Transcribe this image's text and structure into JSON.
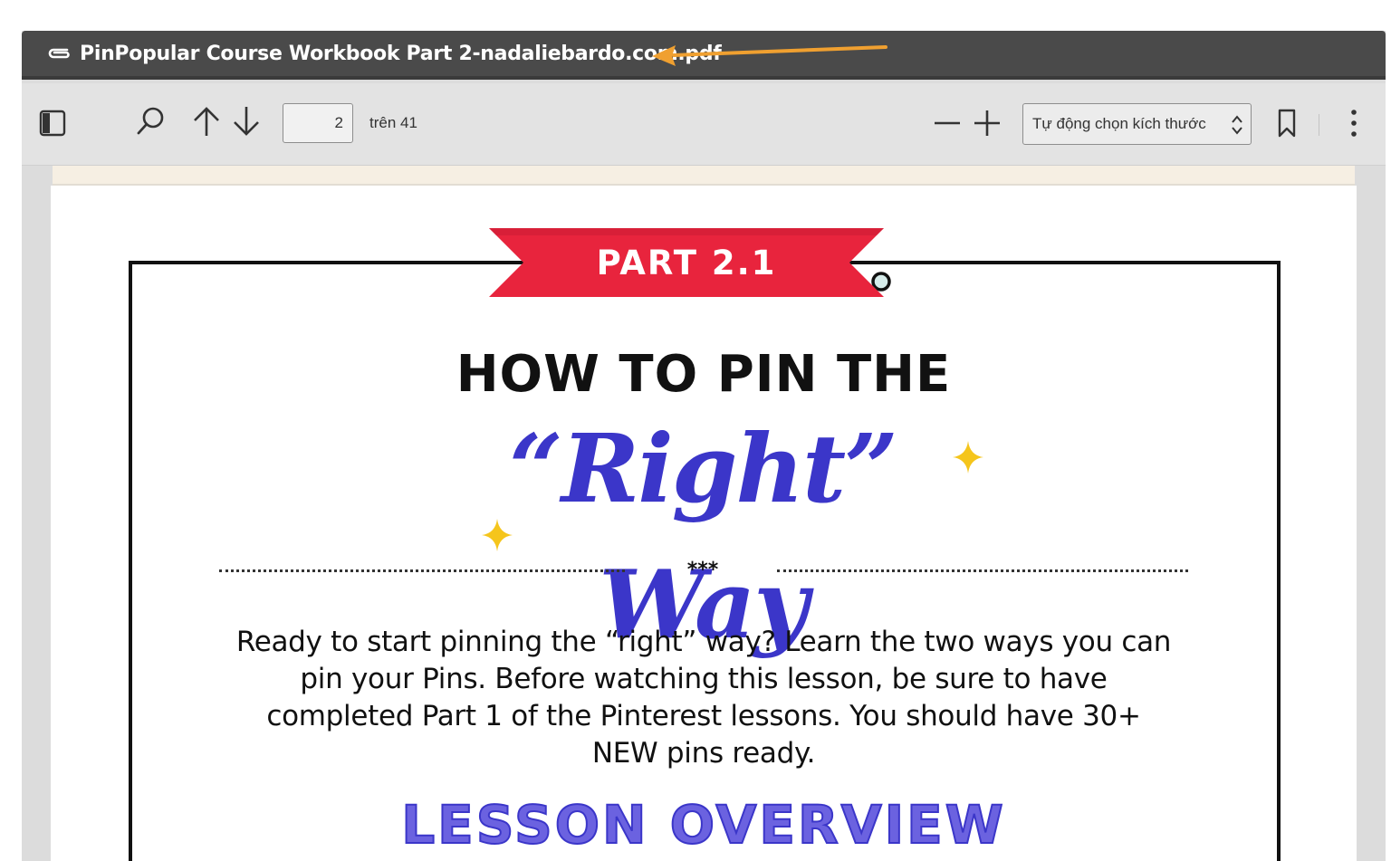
{
  "window": {
    "title": "PinPopular Course Workbook Part 2-nadaliebardo.com.pdf",
    "title_icon": "paperclip-icon",
    "annotation_color": "#f0a030"
  },
  "toolbar": {
    "sidebar_toggle_icon": "sidebar-toggle-icon",
    "search_icon": "search-icon",
    "prev_page_icon": "arrow-up-icon",
    "next_page_icon": "arrow-down-icon",
    "page_number": "2",
    "page_total_label": "trên 41",
    "zoom_out_icon": "minus-icon",
    "zoom_in_icon": "plus-icon",
    "zoom_value": "Tự động chọn kích thước",
    "bookmark_icon": "bookmark-icon",
    "more_icon": "more-vertical-icon"
  },
  "document": {
    "ribbon_label": "PART 2.1",
    "ribbon_color": "#e8243d",
    "heading": "HOW TO PIN THE",
    "script_title": "“Right” Way",
    "script_color": "#3b36c9",
    "sparkle_color": "#f5c51c",
    "divider_stars": "***",
    "body": "Ready to start pinning the “right” way? Learn the two ways you can pin your Pins. Before watching this lesson, be sure to have completed Part 1 of the Pinterest lessons. You should have 30+ NEW pins ready.",
    "section_heading": "LESSON OVERVIEW",
    "section_color": "#6b62e0"
  }
}
